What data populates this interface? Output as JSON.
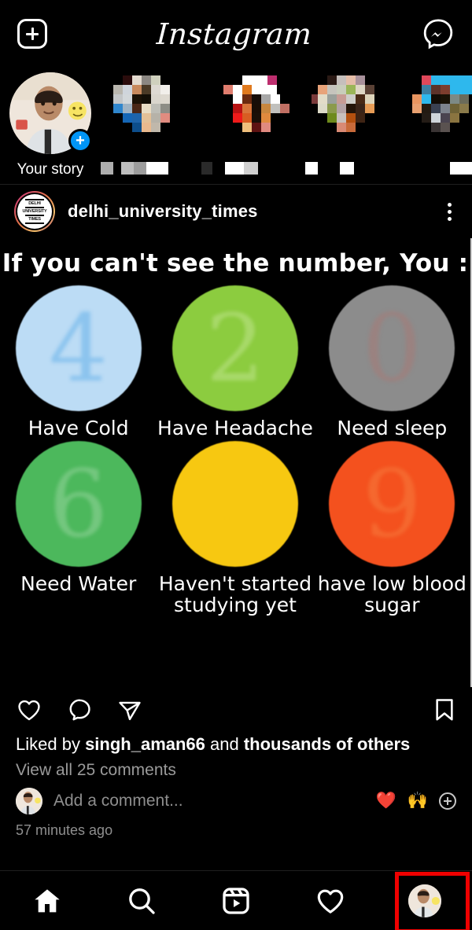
{
  "app": {
    "title": "Instagram",
    "add_icon": "plus-square-icon",
    "messenger_icon": "messenger-icon"
  },
  "stories": {
    "your_story_label": "Your story",
    "your_story_badge": "+",
    "items": [
      {
        "label": "Your story",
        "censored": false
      },
      {
        "label": "",
        "censored": true
      },
      {
        "label": "",
        "censored": true
      },
      {
        "label": "",
        "censored": true
      },
      {
        "label": "",
        "censored": true
      }
    ]
  },
  "post": {
    "username": "delhi_university_times",
    "avatar_logo_line1": "DELHI",
    "avatar_logo_line2": "UNIVERSITY",
    "avatar_logo_line3": "TIMES",
    "menu_icon": "more-options-icon",
    "media": {
      "title": "If you can't see the number, You :",
      "cells": [
        {
          "number": "4",
          "label": "Have Cold",
          "circle_color": "#bcdcf5",
          "number_color": "#8cc4ee"
        },
        {
          "number": "2",
          "label": "Have Headache",
          "circle_color": "#8ccc3f",
          "number_color": "#a8d96a"
        },
        {
          "number": "0",
          "label": "Need sleep",
          "circle_color": "#8c8c8c",
          "number_color": "#9a8280"
        },
        {
          "number": "6",
          "label": "Need Water",
          "circle_color": "#4cb85c",
          "number_color": "#74c77f"
        },
        {
          "number": "",
          "label": "Haven't started studying yet",
          "circle_color": "#f7c811",
          "number_color": "#f7c811"
        },
        {
          "number": "9",
          "label": "have low blood sugar",
          "circle_color": "#f4511e",
          "number_color": "#f5682f"
        }
      ]
    },
    "actions": {
      "like_icon": "heart-icon",
      "comment_icon": "comment-icon",
      "share_icon": "share-icon",
      "save_icon": "bookmark-icon"
    },
    "likes_prefix": "Liked by ",
    "likes_user": "singh_aman66",
    "likes_middle": " and ",
    "likes_suffix": "thousands of others",
    "view_comments": "View all 25 comments",
    "comment_placeholder": "Add a comment...",
    "quick_emoji_1": "❤️",
    "quick_emoji_2": "🙌",
    "add_emoji_icon": "plus-circle-icon",
    "timestamp": "57 minutes ago"
  },
  "bottom_nav": {
    "items": [
      {
        "name": "home",
        "icon": "home-icon",
        "active": true
      },
      {
        "name": "search",
        "icon": "search-icon",
        "active": false
      },
      {
        "name": "reels",
        "icon": "reels-icon",
        "active": false
      },
      {
        "name": "activity",
        "icon": "heart-icon",
        "active": false
      },
      {
        "name": "profile",
        "icon": "profile-avatar",
        "active": false
      }
    ]
  },
  "annotation": {
    "highlight_color": "#ef0000",
    "highlight_target": "profile",
    "watermark": ""
  }
}
